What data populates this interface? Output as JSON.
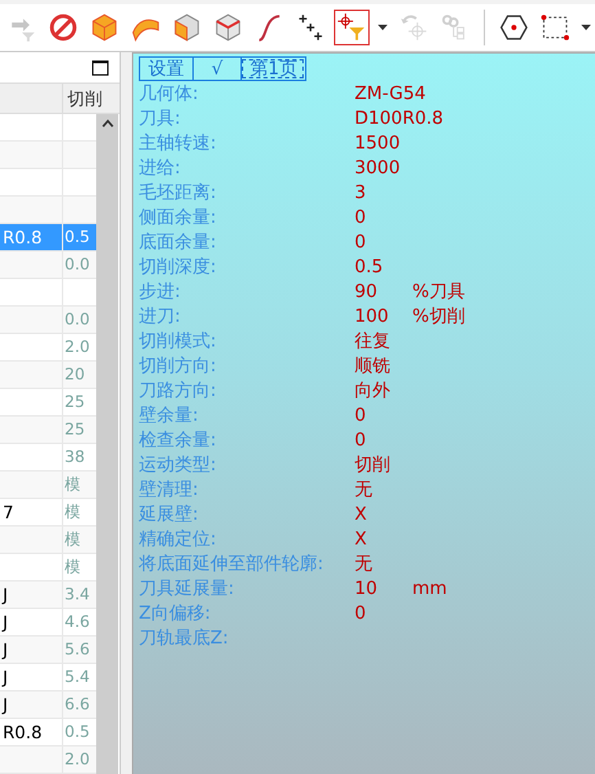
{
  "toolbar": {
    "groups": [
      [
        {
          "kind": "arrow-filter",
          "disabled": true,
          "active": false
        },
        {
          "kind": "prohibit",
          "disabled": false,
          "active": false
        },
        {
          "kind": "cube",
          "disabled": false,
          "active": false
        },
        {
          "kind": "surface",
          "disabled": false,
          "active": false
        },
        {
          "kind": "cube-face",
          "disabled": false,
          "active": false
        },
        {
          "kind": "cube-edge",
          "disabled": false,
          "active": false
        },
        {
          "kind": "curve",
          "disabled": false,
          "active": false
        },
        {
          "kind": "points",
          "disabled": false,
          "active": false
        },
        {
          "kind": "point-filter",
          "disabled": false,
          "active": true
        },
        {
          "kind": "dropdown",
          "disabled": false,
          "active": false
        },
        {
          "kind": "crosshair-undo",
          "disabled": true,
          "active": false
        },
        {
          "kind": "chain",
          "disabled": true,
          "active": false
        }
      ],
      [
        {
          "kind": "hexagon",
          "disabled": false,
          "active": false
        },
        {
          "kind": "dashed-rect",
          "disabled": false,
          "active": false
        },
        {
          "kind": "dropdown",
          "disabled": false,
          "active": false
        }
      ]
    ]
  },
  "table": {
    "column_2_header": "切削",
    "rows": [
      {
        "selected": false
      },
      {
        "selected": false
      },
      {
        "selected": false
      },
      {
        "selected": false
      },
      {
        "column_1": "R0.8",
        "column_2": "0.5",
        "selected": true
      },
      {
        "column_2": "0.0",
        "selected": false
      },
      {
        "selected": false
      },
      {
        "column_2": "0.0",
        "selected": false
      },
      {
        "column_2": "2.0",
        "selected": false
      },
      {
        "column_2": "20",
        "selected": false
      },
      {
        "column_2": "25",
        "selected": false
      },
      {
        "column_2": "25",
        "selected": false
      },
      {
        "column_2": "38",
        "selected": false
      },
      {
        "column_2": "模",
        "selected": false
      },
      {
        "column_1": "7",
        "column_2": "模",
        "selected": false
      },
      {
        "column_2": "模",
        "selected": false
      },
      {
        "column_2": "模",
        "selected": false
      },
      {
        "column_1": "J",
        "column_2": "3.4",
        "selected": false
      },
      {
        "column_1": "J",
        "column_2": "4.6",
        "selected": false
      },
      {
        "column_1": "J",
        "column_2": "5.6",
        "selected": false
      },
      {
        "column_1": "J",
        "column_2": "5.4",
        "selected": false
      },
      {
        "column_1": "J",
        "column_2": "6.6",
        "selected": false
      },
      {
        "column_1": "R0.8",
        "column_2": "0.5",
        "selected": false
      },
      {
        "column_2": "2.0",
        "selected": false
      }
    ]
  },
  "params": {
    "tabs": [
      {
        "label": "设置",
        "selected": false
      },
      {
        "label": "√",
        "selected": false
      },
      {
        "label": "第1页",
        "selected": true
      }
    ],
    "rows": [
      {
        "label": "几何体:",
        "value": "ZM-G54"
      },
      {
        "label": "刀具:",
        "value": "D100R0.8"
      },
      {
        "label": "主轴转速:",
        "value": "1500"
      },
      {
        "label": "进给:",
        "value": "3000"
      },
      {
        "label": "毛坯距离:",
        "value": "3"
      },
      {
        "label": "侧面余量:",
        "value": "0"
      },
      {
        "label": "底面余量:",
        "value": "0"
      },
      {
        "label": "切削深度:",
        "value": "0.5"
      },
      {
        "label": "步进:",
        "value": "90",
        "unit": "%刀具"
      },
      {
        "label": "进刀:",
        "value": "100",
        "unit": "%切削"
      },
      {
        "label": "切削模式:",
        "value": "往复"
      },
      {
        "label": "切削方向:",
        "value": "顺铣"
      },
      {
        "label": "刀路方向:",
        "value": "向外"
      },
      {
        "label": "壁余量:",
        "value": "0"
      },
      {
        "label": "检查余量:",
        "value": "0"
      },
      {
        "label": "运动类型:",
        "value": "切削"
      },
      {
        "label": "壁清理:",
        "value": "无"
      },
      {
        "label": "延展壁:",
        "value": "X"
      },
      {
        "label": "精确定位:",
        "value": "X"
      },
      {
        "label": "将底面延伸至部件轮廓:",
        "value": "无"
      },
      {
        "label": "刀具延展量:",
        "value": "10",
        "unit": "mm"
      },
      {
        "label": "Z向偏移:",
        "value": "0"
      },
      {
        "label": "刀轨最底Z:"
      }
    ]
  }
}
